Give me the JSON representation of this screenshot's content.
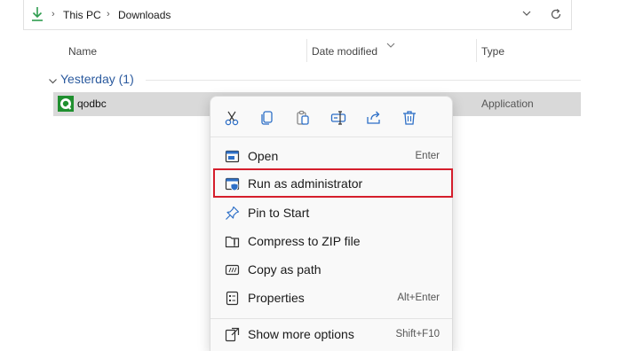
{
  "address": {
    "crumbs": [
      "This PC",
      "Downloads"
    ]
  },
  "columns": {
    "name": "Name",
    "date_modified": "Date modified",
    "type": "Type"
  },
  "group": {
    "label": "Yesterday (1)"
  },
  "file": {
    "name": "qodbc",
    "type": "Application"
  },
  "context_menu": {
    "quick_actions": [
      "cut-icon",
      "copy-icon",
      "paste-icon",
      "rename-icon",
      "share-icon",
      "delete-icon"
    ],
    "items": [
      {
        "label": "Open",
        "shortcut": "Enter",
        "icon": "open-icon"
      },
      {
        "label": "Run as administrator",
        "shortcut": "",
        "icon": "shield-window-icon",
        "highlighted": true
      },
      {
        "label": "Pin to Start",
        "shortcut": "",
        "icon": "pin-icon"
      },
      {
        "label": "Compress to ZIP file",
        "shortcut": "",
        "icon": "zip-folder-icon"
      },
      {
        "label": "Copy as path",
        "shortcut": "",
        "icon": "copy-path-icon"
      },
      {
        "label": "Properties",
        "shortcut": "Alt+Enter",
        "icon": "properties-icon"
      },
      {
        "label": "Show more options",
        "shortcut": "Shift+F10",
        "icon": "more-options-icon"
      }
    ],
    "accent_color": "#2d6fc7",
    "highlight_border_color": "#d51e2c"
  }
}
